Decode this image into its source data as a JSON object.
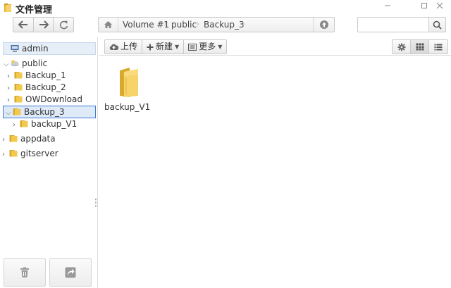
{
  "window": {
    "title": "文件管理",
    "controls": [
      "minimize",
      "maximize",
      "close"
    ]
  },
  "nav": {
    "back_icon": "arrow-left-icon",
    "forward_icon": "arrow-right-icon",
    "refresh_icon": "refresh-icon"
  },
  "path": {
    "home_icon": "home-icon",
    "crumbs": [
      "Volume #1",
      "public",
      "Backup_3"
    ],
    "up_icon": "arrow-up-circle-icon"
  },
  "search": {
    "value": "",
    "placeholder": "",
    "icon": "search-icon"
  },
  "sidebar": {
    "items": [
      {
        "label": "admin",
        "icon": "user-computer-icon",
        "expandable": false,
        "selected": true
      },
      {
        "label": "public",
        "icon": "network-folder-icon",
        "expandable": true,
        "expanded": true
      },
      {
        "label": "Backup_1",
        "icon": "folder-icon",
        "expandable": true
      },
      {
        "label": "Backup_2",
        "icon": "folder-icon",
        "expandable": true
      },
      {
        "label": "OWDownload",
        "icon": "folder-icon",
        "expandable": true
      },
      {
        "label": "Backup_3",
        "icon": "folder-icon",
        "expandable": true,
        "expanded": true,
        "selected": true
      },
      {
        "label": "backup_V1",
        "icon": "folder-icon",
        "expandable": true
      },
      {
        "label": "appdata",
        "icon": "folder-icon",
        "expandable": true
      },
      {
        "label": "gitserver",
        "icon": "folder-icon",
        "expandable": true
      }
    ],
    "bottom": {
      "delete_icon": "trash-icon",
      "share_icon": "share-icon"
    }
  },
  "toolbar": {
    "upload_label": "上传",
    "new_label": "新建",
    "more_label": "更多",
    "settings_icon": "gear-icon",
    "grid_icon": "grid-view-icon",
    "list_icon": "list-view-icon"
  },
  "content": {
    "files": [
      {
        "name": "backup_V1",
        "type": "folder"
      }
    ]
  },
  "colors": {
    "folder": "#f2c94c",
    "folder_dark": "#d9a92e",
    "selection_border": "#3a7bd5",
    "selection_bg": "#dfeaf8"
  }
}
